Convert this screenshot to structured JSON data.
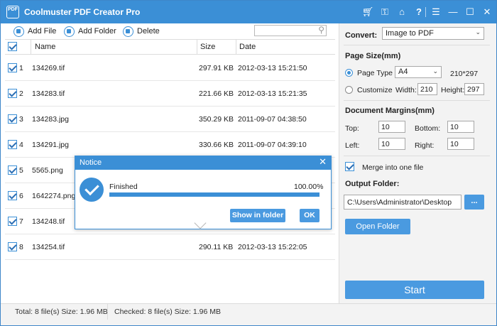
{
  "window": {
    "title": "Coolmuster PDF Creator Pro",
    "logo_text": "PDF",
    "accent": "#3b8fd6"
  },
  "titlebar_icons": [
    "cart-icon",
    "key-icon",
    "home-icon",
    "help-icon",
    "feedback-icon",
    "minimize-icon",
    "maximize-icon",
    "close-icon"
  ],
  "toolbar": {
    "add_file": "Add File",
    "add_folder": "Add Folder",
    "delete": "Delete",
    "search_placeholder": ""
  },
  "table": {
    "columns": [
      "Name",
      "Size",
      "Date"
    ],
    "rows": [
      {
        "index": "1",
        "name": "134269.tif",
        "size": "297.91 KB",
        "date": "2012-03-13 15:21:50"
      },
      {
        "index": "2",
        "name": "134283.tif",
        "size": "221.66 KB",
        "date": "2012-03-13 15:21:35"
      },
      {
        "index": "3",
        "name": "134283.jpg",
        "size": "350.29 KB",
        "date": "2011-09-07 04:38:50"
      },
      {
        "index": "4",
        "name": "134291.jpg",
        "size": "330.66 KB",
        "date": "2011-09-07 04:39:10"
      },
      {
        "index": "5",
        "name": "5565.png",
        "size": "",
        "date": ""
      },
      {
        "index": "6",
        "name": "1642274.png",
        "size": "",
        "date": ""
      },
      {
        "index": "7",
        "name": "134248.tif",
        "size": "",
        "date": ""
      },
      {
        "index": "8",
        "name": "134254.tif",
        "size": "290.11 KB",
        "date": "2012-03-13 15:22:05"
      }
    ]
  },
  "status": {
    "total": "Total: 8 file(s) Size: 1.96 MB",
    "checked": "Checked: 8 file(s) Size: 1.96 MB"
  },
  "settings": {
    "convert_label": "Convert:",
    "convert_value": "Image to PDF",
    "page_size_label": "Page Size(mm)",
    "page_type_label": "Page Type",
    "page_type_value": "A4",
    "page_type_dims": "210*297",
    "customize_label": "Customize",
    "width_label": "Width:",
    "width_value": "210",
    "height_label": "Height:",
    "height_value": "297",
    "margins_label": "Document Margins(mm)",
    "top_label": "Top:",
    "top_value": "10",
    "bottom_label": "Bottom:",
    "bottom_value": "10",
    "left_label": "Left:",
    "left_value": "10",
    "right_label": "Right:",
    "right_value": "10",
    "merge_label": "Merge into one file",
    "output_label": "Output Folder:",
    "output_value": "C:\\Users\\Administrator\\Desktop",
    "browse_label": "...",
    "open_folder": "Open Folder",
    "start": "Start"
  },
  "notice": {
    "title": "Notice",
    "close": "✕",
    "status_text": "Finished",
    "percent_text": "100.00%",
    "progress": 1.0,
    "show_in_folder": "Show in folder",
    "ok": "OK"
  }
}
